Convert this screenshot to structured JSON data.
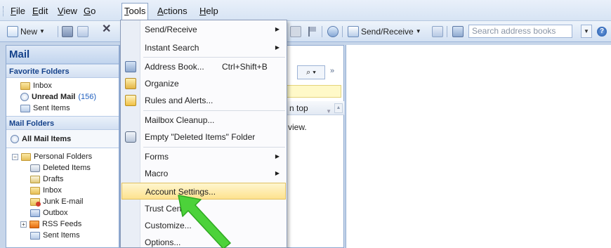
{
  "menubar": {
    "items": [
      {
        "label": "File",
        "accel": "F"
      },
      {
        "label": "Edit",
        "accel": "E"
      },
      {
        "label": "View",
        "accel": "V"
      },
      {
        "label": "Go",
        "accel": "G"
      },
      {
        "label": "Tools",
        "accel": "T",
        "active": true
      },
      {
        "label": "Actions",
        "accel": "A"
      },
      {
        "label": "Help",
        "accel": "H"
      }
    ]
  },
  "toolbar": {
    "new_label": "New",
    "send_receive_label": "Send/Receive",
    "search_placeholder": "Search address books"
  },
  "nav": {
    "title": "Mail",
    "favorites_header": "Favorite Folders",
    "favorites": [
      {
        "label": "Inbox",
        "icon": "folder-icon"
      },
      {
        "label": "Unread Mail",
        "count": "(156)",
        "icon": "search-folder-icon",
        "bold": true
      },
      {
        "label": "Sent Items",
        "icon": "sent-items-icon"
      }
    ],
    "mail_folders_header": "Mail Folders",
    "all_mail_items": "All Mail Items",
    "personal_folders": "Personal Folders",
    "folders": [
      {
        "label": "Deleted Items",
        "icon": "deleted-items-icon"
      },
      {
        "label": "Drafts",
        "icon": "drafts-icon"
      },
      {
        "label": "Inbox",
        "icon": "folder-icon"
      },
      {
        "label": "Junk E-mail",
        "icon": "junk-mail-icon"
      },
      {
        "label": "Outbox",
        "icon": "outbox-icon"
      },
      {
        "label": "RSS Feeds",
        "icon": "rss-feed-icon",
        "expandable": true
      },
      {
        "label": "Sent Items",
        "icon": "sent-items-icon"
      }
    ]
  },
  "middle": {
    "arrange_text": "n top",
    "empty_text": "view."
  },
  "tools_menu": {
    "items": [
      {
        "label": "Send/Receive",
        "submenu": true
      },
      {
        "label": "Instant Search",
        "submenu": true
      },
      {
        "label": "Address Book...",
        "shortcut": "Ctrl+Shift+B",
        "icon": "address-book-icon"
      },
      {
        "label": "Organize",
        "icon": "organize-icon"
      },
      {
        "label": "Rules and Alerts...",
        "icon": "rules-alerts-icon"
      },
      {
        "label": "Mailbox Cleanup..."
      },
      {
        "label": "Empty \"Deleted Items\" Folder",
        "icon": "empty-trash-icon"
      },
      {
        "label": "Forms",
        "submenu": true
      },
      {
        "label": "Macro",
        "submenu": true
      },
      {
        "label": "Account Settings...",
        "highlighted": true
      },
      {
        "label": "Trust Center..."
      },
      {
        "label": "Customize..."
      },
      {
        "label": "Options..."
      }
    ]
  },
  "colors": {
    "accent": "#15428b",
    "highlight": "#fde28f",
    "pointer": "#4cd23a"
  }
}
